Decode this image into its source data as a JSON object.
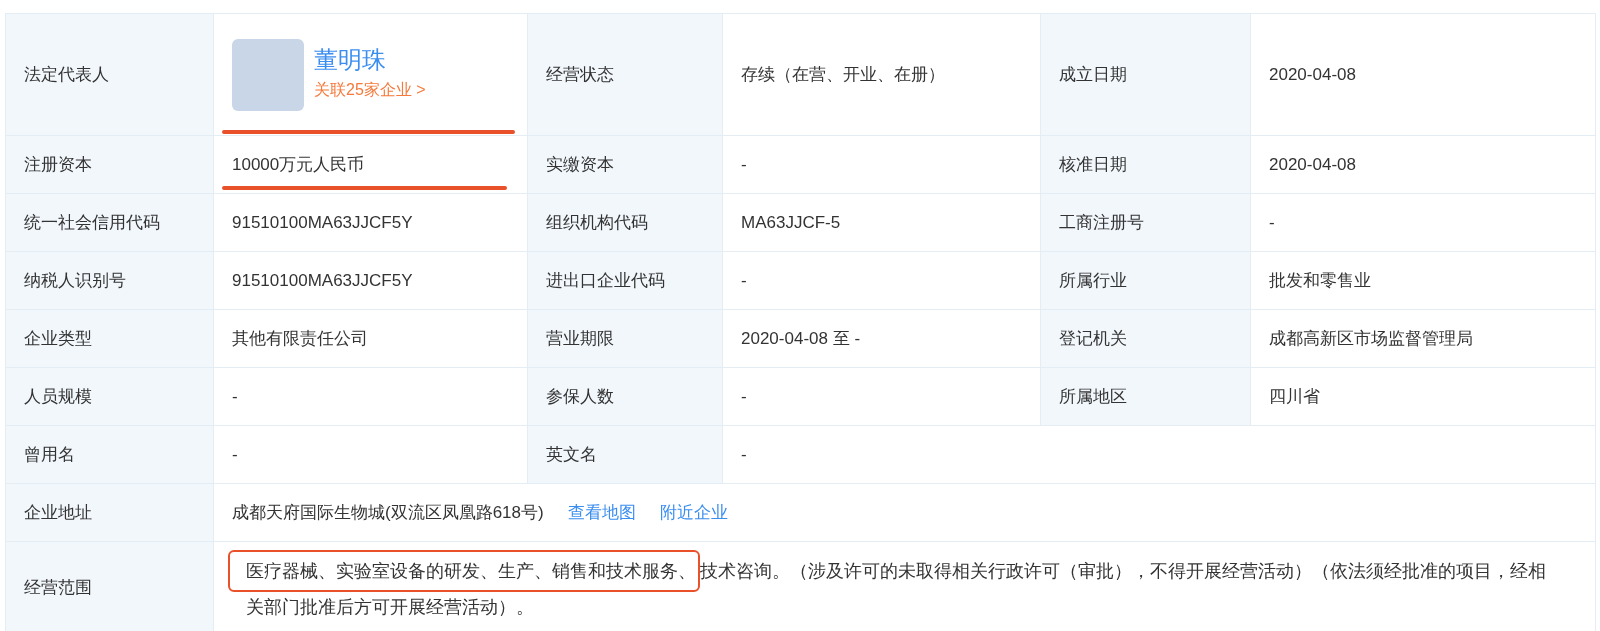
{
  "rows": [
    {
      "cells": [
        {
          "kind": "label",
          "text": "法定代表人"
        },
        {
          "kind": "person",
          "name": "董明珠",
          "link": "关联25家企业 >",
          "underlined": true
        },
        {
          "kind": "label",
          "text": "经营状态"
        },
        {
          "kind": "value",
          "text": "存续（在营、开业、在册）"
        },
        {
          "kind": "label",
          "text": "成立日期"
        },
        {
          "kind": "value",
          "text": "2020-04-08"
        }
      ]
    },
    {
      "cells": [
        {
          "kind": "label",
          "text": "注册资本"
        },
        {
          "kind": "value",
          "text": "10000万元人民币",
          "underlined": true
        },
        {
          "kind": "label",
          "text": "实缴资本"
        },
        {
          "kind": "value",
          "text": "-"
        },
        {
          "kind": "label",
          "text": "核准日期"
        },
        {
          "kind": "value",
          "text": "2020-04-08"
        }
      ]
    },
    {
      "cells": [
        {
          "kind": "label",
          "text": "统一社会信用代码"
        },
        {
          "kind": "value",
          "text": "91510100MA63JJCF5Y"
        },
        {
          "kind": "label",
          "text": "组织机构代码"
        },
        {
          "kind": "value",
          "text": "MA63JJCF-5"
        },
        {
          "kind": "label",
          "text": "工商注册号"
        },
        {
          "kind": "value",
          "text": "-"
        }
      ]
    },
    {
      "cells": [
        {
          "kind": "label",
          "text": "纳税人识别号"
        },
        {
          "kind": "value",
          "text": "91510100MA63JJCF5Y"
        },
        {
          "kind": "label",
          "text": "进出口企业代码"
        },
        {
          "kind": "value",
          "text": "-"
        },
        {
          "kind": "label",
          "text": "所属行业"
        },
        {
          "kind": "value",
          "text": "批发和零售业"
        }
      ]
    },
    {
      "cells": [
        {
          "kind": "label",
          "text": "企业类型"
        },
        {
          "kind": "value",
          "text": "其他有限责任公司"
        },
        {
          "kind": "label",
          "text": "营业期限"
        },
        {
          "kind": "value",
          "text": "2020-04-08 至 -"
        },
        {
          "kind": "label",
          "text": "登记机关"
        },
        {
          "kind": "value",
          "text": "成都高新区市场监督管理局"
        }
      ]
    },
    {
      "cells": [
        {
          "kind": "label",
          "text": "人员规模"
        },
        {
          "kind": "value",
          "text": "-"
        },
        {
          "kind": "label",
          "text": "参保人数"
        },
        {
          "kind": "value",
          "text": "-"
        },
        {
          "kind": "label",
          "text": "所属地区"
        },
        {
          "kind": "value",
          "text": "四川省"
        }
      ]
    },
    {
      "cells": [
        {
          "kind": "label",
          "text": "曾用名"
        },
        {
          "kind": "value",
          "text": "-"
        },
        {
          "kind": "label",
          "text": "英文名"
        },
        {
          "kind": "value",
          "text": "-"
        }
      ]
    },
    {
      "cells": [
        {
          "kind": "label",
          "text": "企业地址"
        },
        {
          "kind": "address",
          "text": "成都天府国际生物城(双流区凤凰路618号)",
          "links": [
            "查看地图",
            "附近企业"
          ]
        }
      ]
    },
    {
      "cells": [
        {
          "kind": "label",
          "text": "经营范围"
        },
        {
          "kind": "scope",
          "highlighted": "医疗器械、实验室设备的研发、生产、销售和技术服务、",
          "rest": "技术咨询。（涉及许可的未取得相关行政许可（审批），不得开展经营活动）（依法须经批准的项目，经相",
          "line2": "关部门批准后方可开展经营活动）。"
        }
      ]
    }
  ]
}
